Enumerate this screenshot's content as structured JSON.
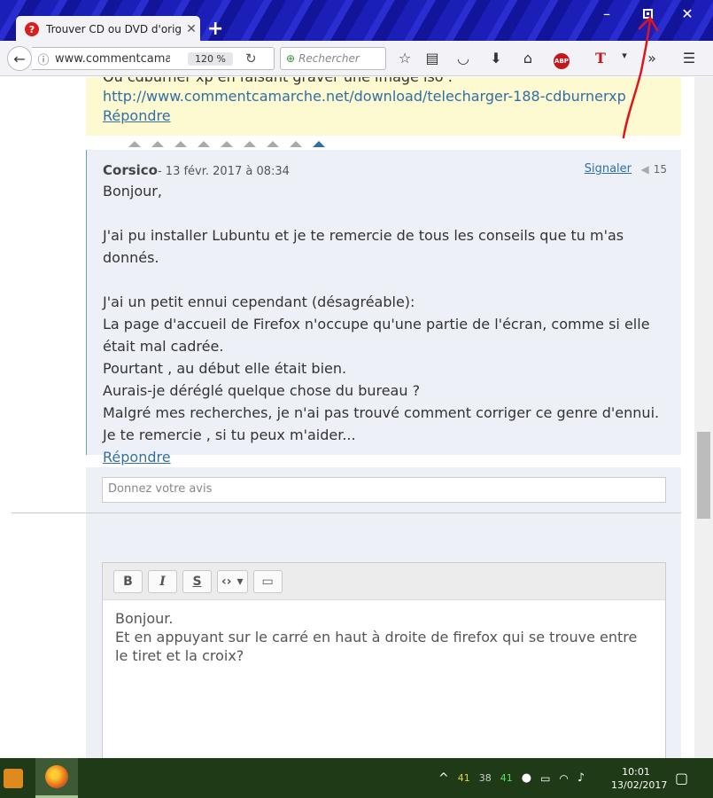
{
  "browser": {
    "tab_title": "Trouver CD ou DVD d'orig...",
    "tab_favicon": "?",
    "url": "www.commentcamar",
    "zoom": "120 %",
    "search_placeholder": "Rechercher",
    "abp_label": "ABP",
    "accent": "#1b1fb8"
  },
  "window": {
    "minimize": "–",
    "close": "✕",
    "new_tab": "+"
  },
  "previous_post": {
    "cut_line": "Ou cdburner xp en faisant graver une image iso :",
    "link": "http://www.commentcamarche.net/download/telecharger-188-cdburnerxp",
    "reply": "Répondre"
  },
  "post": {
    "author": "Corsico",
    "date": "- 13 févr. 2017 à 08:34",
    "report": "Signaler",
    "votes": "15",
    "lines": [
      "Bonjour,",
      "",
      "J'ai pu installer Lubuntu et je te remercie de tous les conseils que tu m'as donnés.",
      "",
      "J'ai un petit ennui cependant (désagréable):",
      "La page d'accueil de Firefox n'occupe qu'une partie de l'écran, comme si elle était mal cadrée.",
      "Pourtant , au début elle était bien.",
      "Aurais-je déréglé quelque chose du bureau ?",
      "Malgré mes recherches, je n'ai pas trouvé comment corriger ce genre d'ennui.",
      "Je te remercie , si tu peux m'aider..."
    ],
    "reply": "Répondre"
  },
  "opinion_placeholder": "Donnez votre avis",
  "editor": {
    "buttons": [
      "B",
      "I",
      "S"
    ],
    "code_label": "‹›",
    "dropdown": "▾",
    "image_label": "▭",
    "text_line1": "Bonjour.",
    "text_line2": "Et en appuyant sur le carré en haut à droite de firefox qui se trouve entre le tiret et la croix?"
  },
  "taskbar": {
    "tray_values": [
      "41",
      "38",
      "41"
    ],
    "time": "10:01",
    "date": "13/02/2017"
  }
}
